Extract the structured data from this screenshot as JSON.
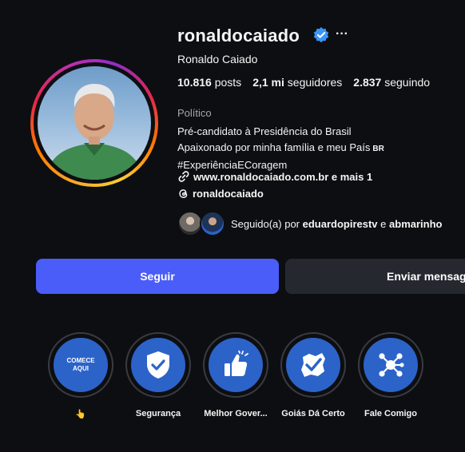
{
  "profile": {
    "username": "ronaldocaiado",
    "full_name": "Ronaldo Caiado",
    "posts_count": "10.816",
    "posts_label": "posts",
    "followers_count": "2,1 mi",
    "followers_label": "seguidores",
    "following_count": "2.837",
    "following_label": "seguindo",
    "category": "Político",
    "bio_line1": "Pré-candidato à Presidência do Brasil",
    "bio_line2": "Apaixonado por minha família e meu País",
    "bio_flag": "BR",
    "bio_line3": "#ExperiênciaECoragem",
    "link_text": "www.ronaldocaiado.com.br e mais 1",
    "threads_handle": "ronaldocaiado"
  },
  "followed_by": {
    "prefix": "Seguido(a) por",
    "user1": "eduardopirestv",
    "conjunction": "e",
    "user2": "abmarinho"
  },
  "actions": {
    "follow_label": "Seguir",
    "message_label": "Enviar mensagem"
  },
  "highlights": [
    {
      "label": "👆",
      "inner_text_line1": "COMECE",
      "inner_text_line2": "AQUI",
      "icon": "text-cover"
    },
    {
      "label": "Segurança",
      "icon": "shield-check-icon"
    },
    {
      "label": "Melhor Gover...",
      "icon": "thumbs-up-icon"
    },
    {
      "label": "Goiás Dá Certo",
      "icon": "goias-map-check-icon"
    },
    {
      "label": "Fale Comigo",
      "icon": "network-icon"
    }
  ],
  "colors": {
    "background": "#0d0e12",
    "follow_button": "#4a5df9",
    "message_button": "#262830",
    "verified_badge": "#3b95f6",
    "highlight_fill": "#2c63c9"
  }
}
